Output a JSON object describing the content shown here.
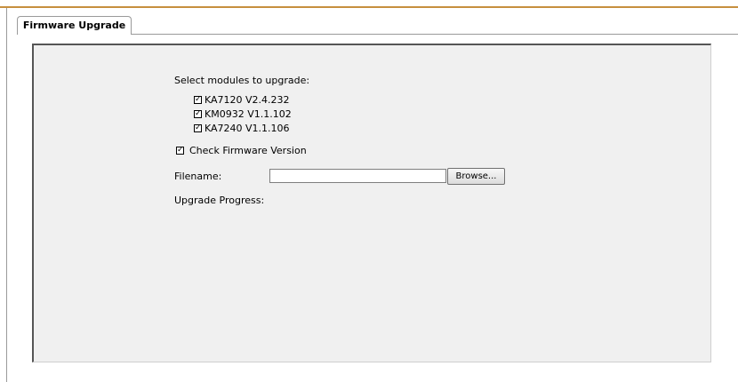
{
  "tab": {
    "label": "Firmware Upgrade"
  },
  "form": {
    "select_label": "Select modules to upgrade:",
    "modules": [
      {
        "label": "KA7120 V2.4.232",
        "checked": true
      },
      {
        "label": "KM0932 V1.1.102",
        "checked": true
      },
      {
        "label": "KA7240 V1.1.106",
        "checked": true
      }
    ],
    "check_firmware": {
      "label": "Check Firmware Version",
      "checked": true
    },
    "filename_label": "Filename:",
    "filename_value": "",
    "browse_label": "Browse...",
    "progress_label": "Upgrade Progress:"
  },
  "colors": {
    "accent_rule": "#c68f3e",
    "panel_bg": "#f0f0f0"
  }
}
